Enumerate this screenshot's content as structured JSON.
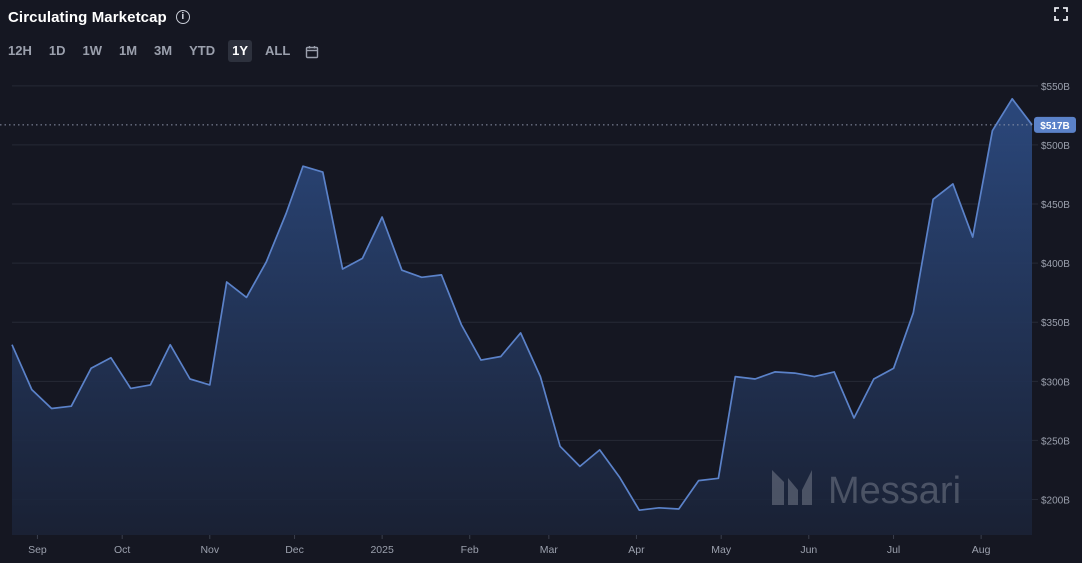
{
  "header": {
    "title": "Circulating Marketcap"
  },
  "icons": {
    "info": "info-icon",
    "expand": "expand-icon",
    "calendar": "calendar-icon"
  },
  "ranges": [
    {
      "label": "12H",
      "active": false
    },
    {
      "label": "1D",
      "active": false
    },
    {
      "label": "1W",
      "active": false
    },
    {
      "label": "1M",
      "active": false
    },
    {
      "label": "3M",
      "active": false
    },
    {
      "label": "YTD",
      "active": false
    },
    {
      "label": "1Y",
      "active": true
    },
    {
      "label": "ALL",
      "active": false
    }
  ],
  "watermark": "Messari",
  "colors": {
    "line": "#5b82c9",
    "badge": "#5b82c9",
    "background": "#151722",
    "grid": "#262a36"
  },
  "chart_data": {
    "type": "area",
    "title": "Circulating Marketcap",
    "xlabel": "",
    "ylabel": "",
    "ylim": [
      170,
      560
    ],
    "y_ticks": [
      200,
      250,
      300,
      350,
      400,
      450,
      500,
      550
    ],
    "y_tick_labels": [
      "$200B",
      "$250B",
      "$300B",
      "$350B",
      "$400B",
      "$450B",
      "$500B",
      "$550B"
    ],
    "x_ticks": [
      "2024-09-01",
      "2024-10-01",
      "2024-11-01",
      "2024-12-01",
      "2025-01-01",
      "2025-02-01",
      "2025-03-01",
      "2025-04-01",
      "2025-05-01",
      "2025-06-01",
      "2025-07-01",
      "2025-08-01"
    ],
    "x_tick_labels": [
      "Sep",
      "Oct",
      "Nov",
      "Dec",
      "2025",
      "Feb",
      "Mar",
      "Apr",
      "May",
      "Jun",
      "Jul",
      "Aug"
    ],
    "current_value": 517,
    "current_label": "$517B",
    "grid": true,
    "series": [
      {
        "points": [
          [
            "2024-08-23",
            331
          ],
          [
            "2024-08-30",
            293
          ],
          [
            "2024-09-06",
            277
          ],
          [
            "2024-09-13",
            279
          ],
          [
            "2024-09-20",
            311
          ],
          [
            "2024-09-27",
            320
          ],
          [
            "2024-10-04",
            294
          ],
          [
            "2024-10-11",
            297
          ],
          [
            "2024-10-18",
            331
          ],
          [
            "2024-10-25",
            302
          ],
          [
            "2024-11-01",
            297
          ],
          [
            "2024-11-07",
            384
          ],
          [
            "2024-11-14",
            371
          ],
          [
            "2024-11-21",
            401
          ],
          [
            "2024-11-28",
            442
          ],
          [
            "2024-12-04",
            482
          ],
          [
            "2024-12-11",
            477
          ],
          [
            "2024-12-18",
            395
          ],
          [
            "2024-12-25",
            404
          ],
          [
            "2025-01-01",
            439
          ],
          [
            "2025-01-08",
            394
          ],
          [
            "2025-01-15",
            388
          ],
          [
            "2025-01-22",
            390
          ],
          [
            "2025-01-29",
            348
          ],
          [
            "2025-02-05",
            318
          ],
          [
            "2025-02-12",
            321
          ],
          [
            "2025-02-19",
            341
          ],
          [
            "2025-02-26",
            304
          ],
          [
            "2025-03-05",
            245
          ],
          [
            "2025-03-12",
            228
          ],
          [
            "2025-03-19",
            242
          ],
          [
            "2025-03-26",
            219
          ],
          [
            "2025-04-02",
            191
          ],
          [
            "2025-04-09",
            193
          ],
          [
            "2025-04-16",
            192
          ],
          [
            "2025-04-23",
            216
          ],
          [
            "2025-04-30",
            218
          ],
          [
            "2025-05-06",
            304
          ],
          [
            "2025-05-13",
            302
          ],
          [
            "2025-05-20",
            308
          ],
          [
            "2025-05-27",
            307
          ],
          [
            "2025-06-03",
            304
          ],
          [
            "2025-06-10",
            308
          ],
          [
            "2025-06-17",
            269
          ],
          [
            "2025-06-24",
            302
          ],
          [
            "2025-07-01",
            311
          ],
          [
            "2025-07-08",
            358
          ],
          [
            "2025-07-15",
            454
          ],
          [
            "2025-07-22",
            467
          ],
          [
            "2025-07-29",
            422
          ],
          [
            "2025-08-05",
            512
          ],
          [
            "2025-08-12",
            539
          ],
          [
            "2025-08-19",
            517
          ]
        ]
      }
    ]
  }
}
